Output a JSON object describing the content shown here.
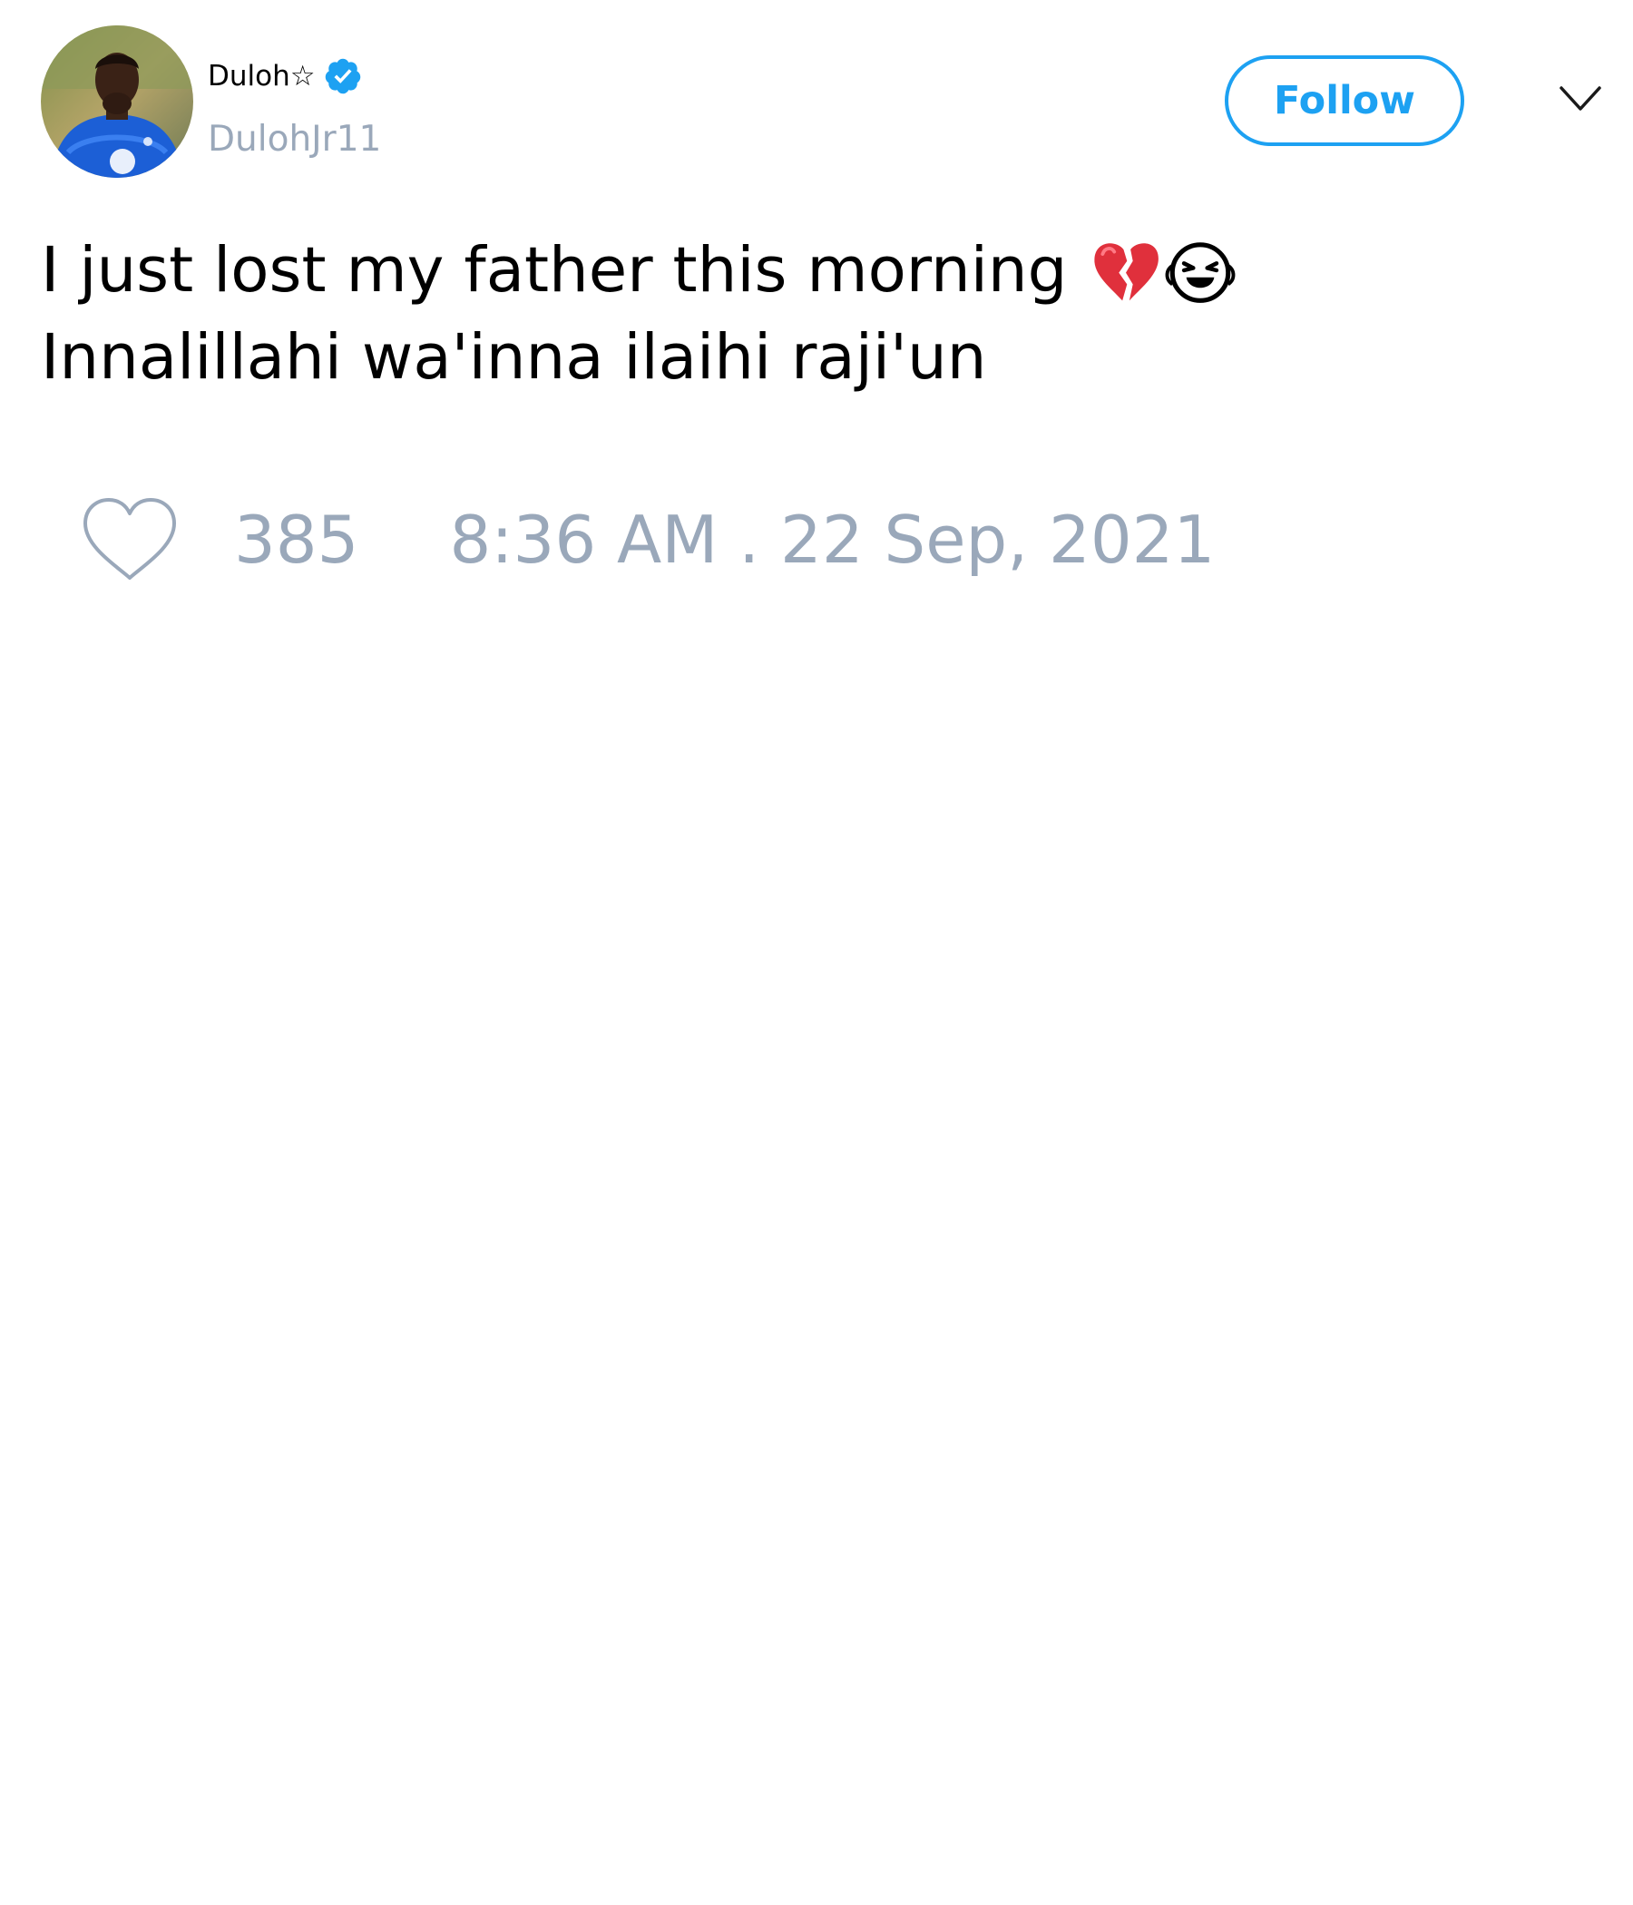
{
  "author": {
    "display_name": "Duloh☆",
    "handle": "DulohJr11",
    "verified": true,
    "avatar_icon": "profile-photo"
  },
  "actions": {
    "follow_label": "Follow",
    "menu_icon": "chevron-down-icon"
  },
  "tweet": {
    "line1_text": "I just lost my father this morning",
    "line1_emojis": [
      "broken-heart",
      "loudly-crying-face"
    ],
    "line2_text": "Innalillahi wa'inna ilaihi raji'un"
  },
  "footer": {
    "like_icon": "heart-icon",
    "like_count": "385",
    "timestamp": "8:36 AM . 22 Sep, 2021"
  },
  "colors": {
    "accent": "#1da1f2",
    "muted": "#9aa8ba",
    "text": "#000000",
    "background": "#ffffff"
  }
}
